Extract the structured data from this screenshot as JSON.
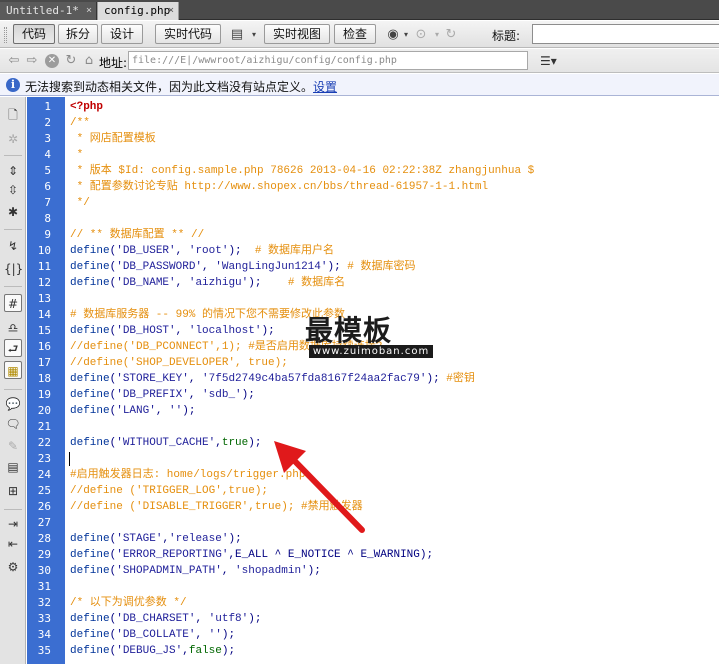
{
  "tabs": [
    {
      "label": "Untitled-1*",
      "active": false
    },
    {
      "label": "config.php",
      "active": true
    }
  ],
  "tab_close_glyph": "×",
  "toolbar": {
    "code": "代码",
    "split": "拆分",
    "design": "设计",
    "live_code": "实时代码",
    "live_view": "实时视图",
    "inspect": "检查",
    "title_label": "标题:",
    "title_value": ""
  },
  "address": {
    "label": "地址:",
    "value": "file:///E|/wwwroot/aizhigu/config/config.php"
  },
  "infobar": {
    "message": "无法搜索到动态相关文件，因为此文档没有站点定义。",
    "link": "设置"
  },
  "code": {
    "line_numbers": [
      "1",
      "2",
      "3",
      "4",
      "5",
      "6",
      "7",
      "8",
      "9",
      "10",
      "11",
      "12",
      "13",
      "14",
      "15",
      "16",
      "17",
      "18",
      "19",
      "20",
      "21",
      "22",
      "23",
      "24",
      "25",
      "26",
      "27",
      "28",
      "29",
      "30",
      "31",
      "32",
      "33",
      "34",
      "35"
    ],
    "lines": [
      [
        {
          "t": "<?php",
          "c": "php"
        }
      ],
      [
        {
          "t": "/**",
          "c": "com"
        }
      ],
      [
        {
          "t": " * 网店配置模板",
          "c": "com"
        }
      ],
      [
        {
          "t": " *",
          "c": "com"
        }
      ],
      [
        {
          "t": " * 版本 $Id: config.sample.php 78626 2013-04-16 02:22:38Z zhangjunhua $",
          "c": "com"
        }
      ],
      [
        {
          "t": " * 配置参数讨论专贴 http://www.shopex.cn/bbs/thread-61957-1-1.html",
          "c": "com"
        }
      ],
      [
        {
          "t": " */",
          "c": "com"
        }
      ],
      [],
      [
        {
          "t": "// ** 数据库配置 ** //",
          "c": "com"
        }
      ],
      [
        {
          "t": "define",
          "c": "fn"
        },
        {
          "t": "(",
          "c": "p"
        },
        {
          "t": "'DB_USER'",
          "c": "str"
        },
        {
          "t": ", ",
          "c": "p"
        },
        {
          "t": "'root'",
          "c": "str"
        },
        {
          "t": ");  ",
          "c": "p"
        },
        {
          "t": "# 数据库用户名",
          "c": "com"
        }
      ],
      [
        {
          "t": "define",
          "c": "fn"
        },
        {
          "t": "(",
          "c": "p"
        },
        {
          "t": "'DB_PASSWORD'",
          "c": "str"
        },
        {
          "t": ", ",
          "c": "p"
        },
        {
          "t": "'WangLingJun1214'",
          "c": "str"
        },
        {
          "t": "); ",
          "c": "p"
        },
        {
          "t": "# 数据库密码",
          "c": "com"
        }
      ],
      [
        {
          "t": "define",
          "c": "fn"
        },
        {
          "t": "(",
          "c": "p"
        },
        {
          "t": "'DB_NAME'",
          "c": "str"
        },
        {
          "t": ", ",
          "c": "p"
        },
        {
          "t": "'aizhigu'",
          "c": "str"
        },
        {
          "t": ");    ",
          "c": "p"
        },
        {
          "t": "# 数据库名",
          "c": "com"
        }
      ],
      [],
      [
        {
          "t": "# 数据库服务器 -- 99% 的情况下您不需要修改此参数",
          "c": "com"
        }
      ],
      [
        {
          "t": "define",
          "c": "fn"
        },
        {
          "t": "(",
          "c": "p"
        },
        {
          "t": "'DB_HOST'",
          "c": "str"
        },
        {
          "t": ", ",
          "c": "p"
        },
        {
          "t": "'localhost'",
          "c": "str"
        },
        {
          "t": ");",
          "c": "p"
        }
      ],
      [
        {
          "t": "//define('DB_PCONNECT',1); #是否启用数据库持续连接?",
          "c": "com"
        }
      ],
      [
        {
          "t": "//define('SHOP_DEVELOPER', true);",
          "c": "com"
        }
      ],
      [
        {
          "t": "define",
          "c": "fn"
        },
        {
          "t": "(",
          "c": "p"
        },
        {
          "t": "'STORE_KEY'",
          "c": "str"
        },
        {
          "t": ", ",
          "c": "p"
        },
        {
          "t": "'7f5d2749c4ba57fda8167f24aa2fac79'",
          "c": "str"
        },
        {
          "t": "); ",
          "c": "p"
        },
        {
          "t": "#密钥",
          "c": "com"
        }
      ],
      [
        {
          "t": "define",
          "c": "fn"
        },
        {
          "t": "(",
          "c": "p"
        },
        {
          "t": "'DB_PREFIX'",
          "c": "str"
        },
        {
          "t": ", ",
          "c": "p"
        },
        {
          "t": "'sdb_'",
          "c": "str"
        },
        {
          "t": ");",
          "c": "p"
        }
      ],
      [
        {
          "t": "define",
          "c": "fn"
        },
        {
          "t": "(",
          "c": "p"
        },
        {
          "t": "'LANG'",
          "c": "str"
        },
        {
          "t": ", ",
          "c": "p"
        },
        {
          "t": "''",
          "c": "str"
        },
        {
          "t": ");",
          "c": "p"
        }
      ],
      [],
      [
        {
          "t": "define",
          "c": "fn"
        },
        {
          "t": "(",
          "c": "p"
        },
        {
          "t": "'WITHOUT_CACHE'",
          "c": "str"
        },
        {
          "t": ",",
          "c": "p"
        },
        {
          "t": "true",
          "c": "kw"
        },
        {
          "t": ");",
          "c": "p"
        }
      ],
      [],
      [
        {
          "t": "#启用触发器日志: home/logs/trigger.php",
          "c": "com"
        }
      ],
      [
        {
          "t": "//define ('TRIGGER_LOG',true);",
          "c": "com"
        }
      ],
      [
        {
          "t": "//define ('DISABLE_TRIGGER',true); #禁用触发器",
          "c": "com"
        }
      ],
      [],
      [
        {
          "t": "define",
          "c": "fn"
        },
        {
          "t": "(",
          "c": "p"
        },
        {
          "t": "'STAGE'",
          "c": "str"
        },
        {
          "t": ",",
          "c": "p"
        },
        {
          "t": "'release'",
          "c": "str"
        },
        {
          "t": ");",
          "c": "p"
        }
      ],
      [
        {
          "t": "define",
          "c": "fn"
        },
        {
          "t": "(",
          "c": "p"
        },
        {
          "t": "'ERROR_REPORTING'",
          "c": "str"
        },
        {
          "t": ",E_ALL ^ E_NOTICE ^ E_WARNING);",
          "c": "p"
        }
      ],
      [
        {
          "t": "define",
          "c": "fn"
        },
        {
          "t": "(",
          "c": "p"
        },
        {
          "t": "'SHOPADMIN_PATH'",
          "c": "str"
        },
        {
          "t": ", ",
          "c": "p"
        },
        {
          "t": "'shopadmin'",
          "c": "str"
        },
        {
          "t": ");",
          "c": "p"
        }
      ],
      [],
      [
        {
          "t": "/* 以下为调优参数 */",
          "c": "com"
        }
      ],
      [
        {
          "t": "define",
          "c": "fn"
        },
        {
          "t": "(",
          "c": "p"
        },
        {
          "t": "'DB_CHARSET'",
          "c": "str"
        },
        {
          "t": ", ",
          "c": "p"
        },
        {
          "t": "'utf8'",
          "c": "str"
        },
        {
          "t": ");",
          "c": "p"
        }
      ],
      [
        {
          "t": "define",
          "c": "fn"
        },
        {
          "t": "(",
          "c": "p"
        },
        {
          "t": "'DB_COLLATE'",
          "c": "str"
        },
        {
          "t": ", ",
          "c": "p"
        },
        {
          "t": "''",
          "c": "str"
        },
        {
          "t": ");",
          "c": "p"
        }
      ],
      [
        {
          "t": "define",
          "c": "fn"
        },
        {
          "t": "(",
          "c": "p"
        },
        {
          "t": "'DEBUG_JS'",
          "c": "str"
        },
        {
          "t": ",",
          "c": "p"
        },
        {
          "t": "false",
          "c": "kw"
        },
        {
          "t": ");",
          "c": "p"
        }
      ]
    ]
  },
  "watermark": {
    "title": "最模板",
    "url": "www.zuimoban.com"
  },
  "colors": {
    "gutter": "#3b6ed1",
    "comment": "#e58f0e",
    "arrow": "#e0191b"
  }
}
